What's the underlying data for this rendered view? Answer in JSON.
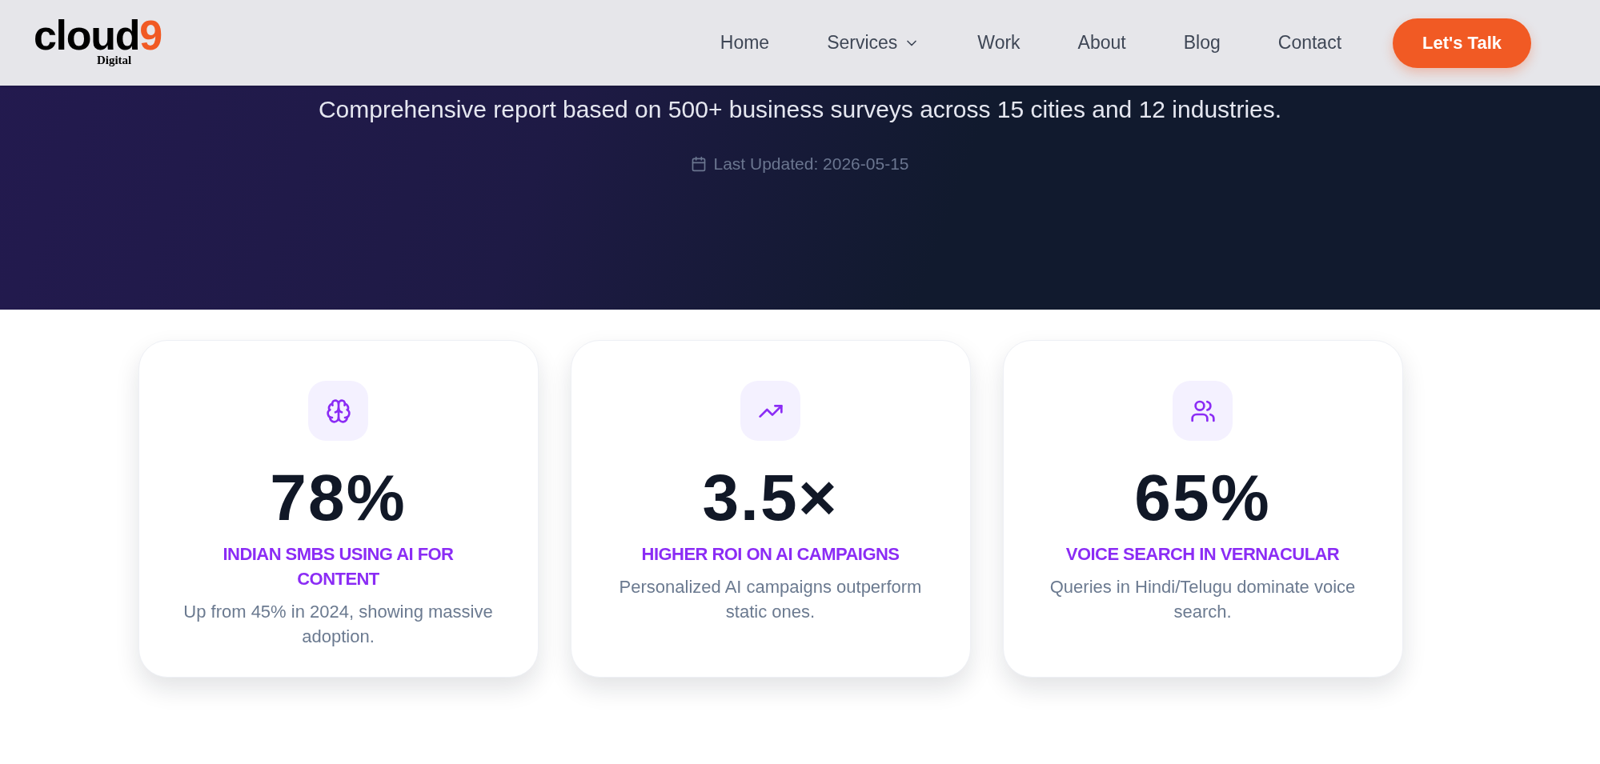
{
  "header": {
    "logo": {
      "word": "cloud",
      "digit": "9",
      "tagline": "Digital"
    },
    "nav": [
      {
        "label": "Home",
        "dropdown": false
      },
      {
        "label": "Services",
        "dropdown": true
      },
      {
        "label": "Work",
        "dropdown": false
      },
      {
        "label": "About",
        "dropdown": false
      },
      {
        "label": "Blog",
        "dropdown": false
      },
      {
        "label": "Contact",
        "dropdown": false
      }
    ],
    "cta": "Let's Talk"
  },
  "hero": {
    "subtitle": "Comprehensive report based on 500+ business surveys across 15 cities and 12 industries.",
    "updated": "Last Updated: 2026-05-15"
  },
  "stats": [
    {
      "kind": "brain",
      "value": "78%",
      "label": "INDIAN SMBS USING AI FOR CONTENT",
      "description": "Up from 45% in 2024, showing massive adoption."
    },
    {
      "kind": "trend",
      "value": "3.5×",
      "label": "HIGHER ROI ON AI CAMPAIGNS",
      "description": "Personalized AI campaigns outperform static ones."
    },
    {
      "kind": "users",
      "value": "65%",
      "label": "VOICE SEARCH IN VERNACULAR",
      "description": "Queries in Hindi/Telugu dominate voice search."
    }
  ]
}
